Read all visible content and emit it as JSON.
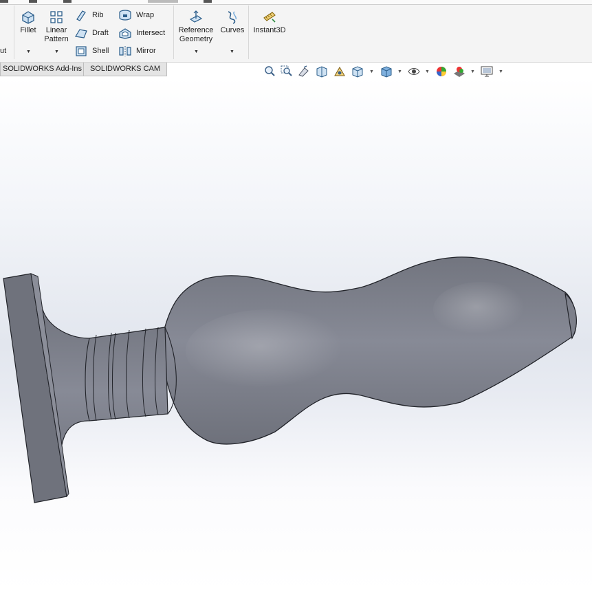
{
  "ribbon": {
    "cut_fragment": "ut",
    "fillet": "Fillet",
    "linear_pattern_line1": "Linear",
    "linear_pattern_line2": "Pattern",
    "rib": "Rib",
    "draft": "Draft",
    "shell": "Shell",
    "wrap": "Wrap",
    "intersect": "Intersect",
    "mirror": "Mirror",
    "ref_geometry_line1": "Reference",
    "ref_geometry_line2": "Geometry",
    "curves": "Curves",
    "instant3d": "Instant3D"
  },
  "tabs": [
    {
      "label": "SOLIDWORKS Add-Ins"
    },
    {
      "label": "SOLIDWORKS CAM"
    }
  ],
  "heads_up_toolbar": {
    "icons": [
      "zoom-to-fit-icon",
      "zoom-to-area-icon",
      "previous-view-icon",
      "section-view-icon",
      "dynamic-annotation-icon",
      "view-orientation-icon",
      "display-style-icon",
      "hide-show-items-icon",
      "edit-appearance-icon",
      "apply-scene-icon",
      "view-settings-icon"
    ]
  },
  "colors": {
    "model": "#80838f",
    "ribbon_bg": "#f4f4f4",
    "viewport_top": "#ffffff",
    "viewport_mid": "#e2e6ee"
  }
}
